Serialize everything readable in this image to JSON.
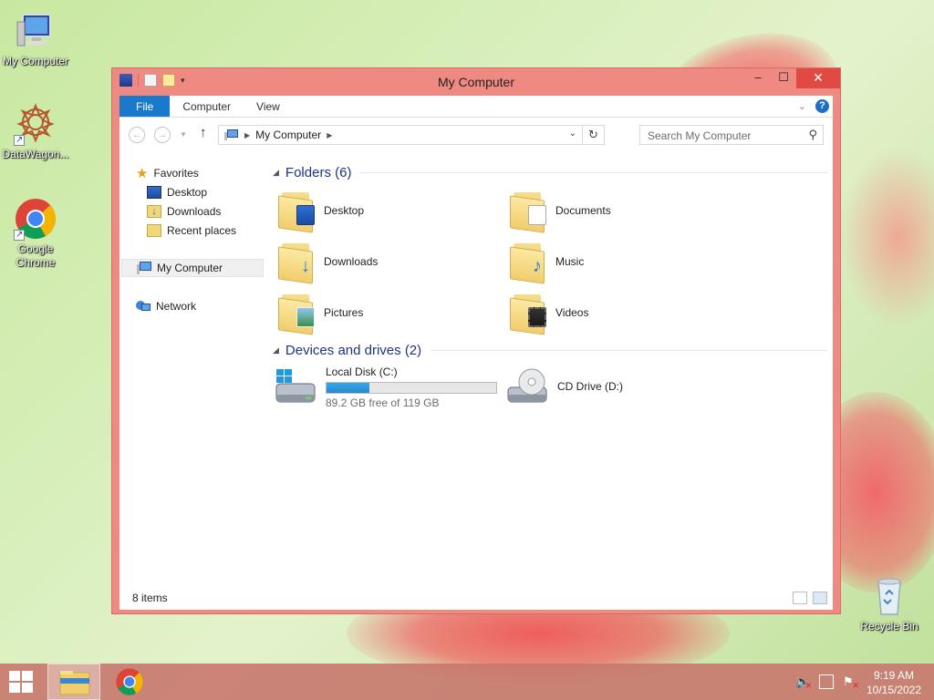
{
  "desktop": {
    "icons": [
      {
        "label": "My Computer"
      },
      {
        "label": "DataWagon..."
      },
      {
        "label": "Google Chrome"
      },
      {
        "label": "Recycle Bin"
      }
    ]
  },
  "window": {
    "title": "My Computer",
    "ribbon_tabs": [
      "File",
      "Computer",
      "View"
    ],
    "address": {
      "path": "My Computer"
    },
    "search": {
      "placeholder": "Search My Computer"
    }
  },
  "navpane": {
    "favorites_label": "Favorites",
    "favorites": [
      "Desktop",
      "Downloads",
      "Recent places"
    ],
    "computer_label": "My Computer",
    "network_label": "Network"
  },
  "folders_group": {
    "title": "Folders (6)",
    "items": [
      "Desktop",
      "Documents",
      "Downloads",
      "Music",
      "Pictures",
      "Videos"
    ]
  },
  "drives_group": {
    "title": "Devices and drives (2)",
    "local_disk": {
      "label": "Local Disk (C:)",
      "free_text": "89.2 GB free of 119 GB",
      "used_fraction": 0.25
    },
    "cd_drive": {
      "label": "CD Drive (D:)"
    }
  },
  "status": {
    "item_count": "8 items"
  },
  "taskbar": {
    "time": "9:19 AM",
    "date": "10/15/2022"
  },
  "colors": {
    "accent": "#1979ca",
    "window_frame": "#ef8a82",
    "close_button": "#e04a43",
    "drive_bar": "#2689cf"
  }
}
